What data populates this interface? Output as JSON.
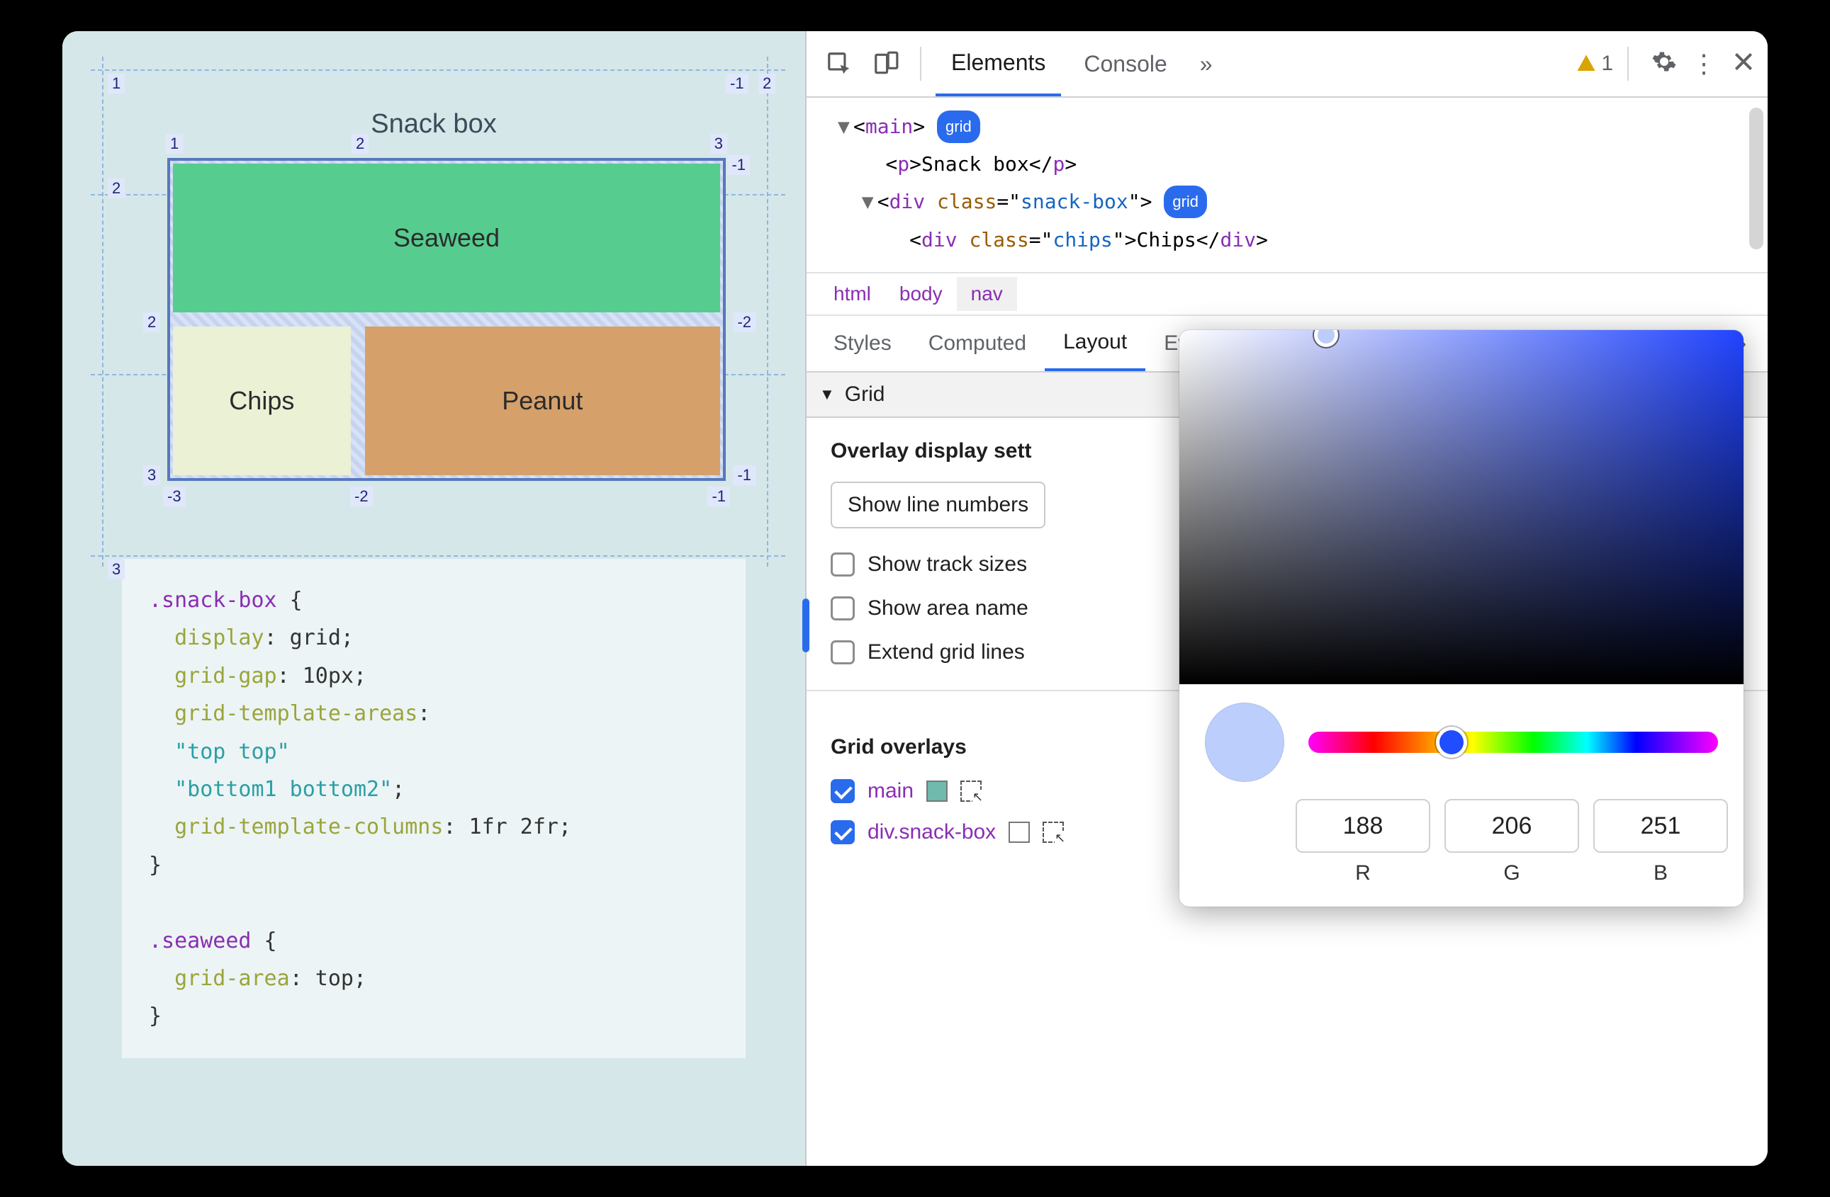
{
  "left": {
    "title": "Snack box",
    "cells": {
      "seaweed": "Seaweed",
      "chips": "Chips",
      "peanut": "Peanut"
    },
    "outer_nums": {
      "tl": "1",
      "tr_neg": "-1",
      "tr2": "2",
      "left2": "2",
      "bl": "3"
    },
    "inner_nums": {
      "top": [
        "1",
        "2",
        "3"
      ],
      "mid_l": "2",
      "mid_r": "-2",
      "bot_l": "3",
      "bot_neg3": "-3",
      "bot_neg2": "-2",
      "bot_r": "-1",
      "r_mid_top": "-1"
    },
    "code_lines": [
      {
        "t": "sel",
        "v": ".snack-box"
      },
      {
        "t": "plain",
        "v": " {\n"
      },
      {
        "t": "pad",
        "v": "  "
      },
      {
        "t": "prop",
        "v": "display"
      },
      {
        "t": "plain",
        "v": ": grid;\n"
      },
      {
        "t": "pad",
        "v": "  "
      },
      {
        "t": "prop",
        "v": "grid-gap"
      },
      {
        "t": "plain",
        "v": ": 10px;\n"
      },
      {
        "t": "pad",
        "v": "  "
      },
      {
        "t": "prop",
        "v": "grid-template-areas"
      },
      {
        "t": "plain",
        "v": ":\n"
      },
      {
        "t": "pad",
        "v": "  "
      },
      {
        "t": "str",
        "v": "\"top top\""
      },
      {
        "t": "plain",
        "v": "\n"
      },
      {
        "t": "pad",
        "v": "  "
      },
      {
        "t": "str",
        "v": "\"bottom1 bottom2\""
      },
      {
        "t": "plain",
        "v": ";\n"
      },
      {
        "t": "pad",
        "v": "  "
      },
      {
        "t": "prop",
        "v": "grid-template-columns"
      },
      {
        "t": "plain",
        "v": ": 1fr 2fr;\n"
      },
      {
        "t": "plain",
        "v": "}\n\n"
      },
      {
        "t": "sel",
        "v": ".seaweed"
      },
      {
        "t": "plain",
        "v": " {\n"
      },
      {
        "t": "pad",
        "v": "  "
      },
      {
        "t": "prop",
        "v": "grid-area"
      },
      {
        "t": "plain",
        "v": ": top;\n"
      },
      {
        "t": "plain",
        "v": "}"
      }
    ]
  },
  "devtools": {
    "tabs": {
      "elements": "Elements",
      "console": "Console"
    },
    "more": "»",
    "warn_count": "1",
    "dom": {
      "l1a": "main",
      "l1_badge": "grid",
      "l2_tag": "p",
      "l2_text": "Snack box",
      "l3_tag": "div",
      "l3_attr": "class",
      "l3_val": "snack-box",
      "l3_badge": "grid",
      "l4_tag": "div",
      "l4_attr": "class",
      "l4_val": "chips",
      "l4_text": "Chips"
    },
    "crumbs": [
      "html",
      "body",
      "nav"
    ],
    "subtabs": {
      "styles": "Styles",
      "computed": "Computed",
      "layout": "Layout",
      "events": "Event Listeners"
    },
    "section": "Grid",
    "overlay": {
      "heading": "Overlay display sett",
      "select": "Show line numbers",
      "track": "Show track sizes",
      "area": "Show area name",
      "extend": "Extend grid lines"
    },
    "grid_overlays": {
      "heading": "Grid overlays",
      "items": [
        {
          "name": "main",
          "swatch": "teal"
        },
        {
          "name": "div.snack-box",
          "swatch": "hollow"
        }
      ]
    }
  },
  "picker": {
    "r": "188",
    "g": "206",
    "b": "251",
    "r_lbl": "R",
    "g_lbl": "G",
    "b_lbl": "B"
  }
}
